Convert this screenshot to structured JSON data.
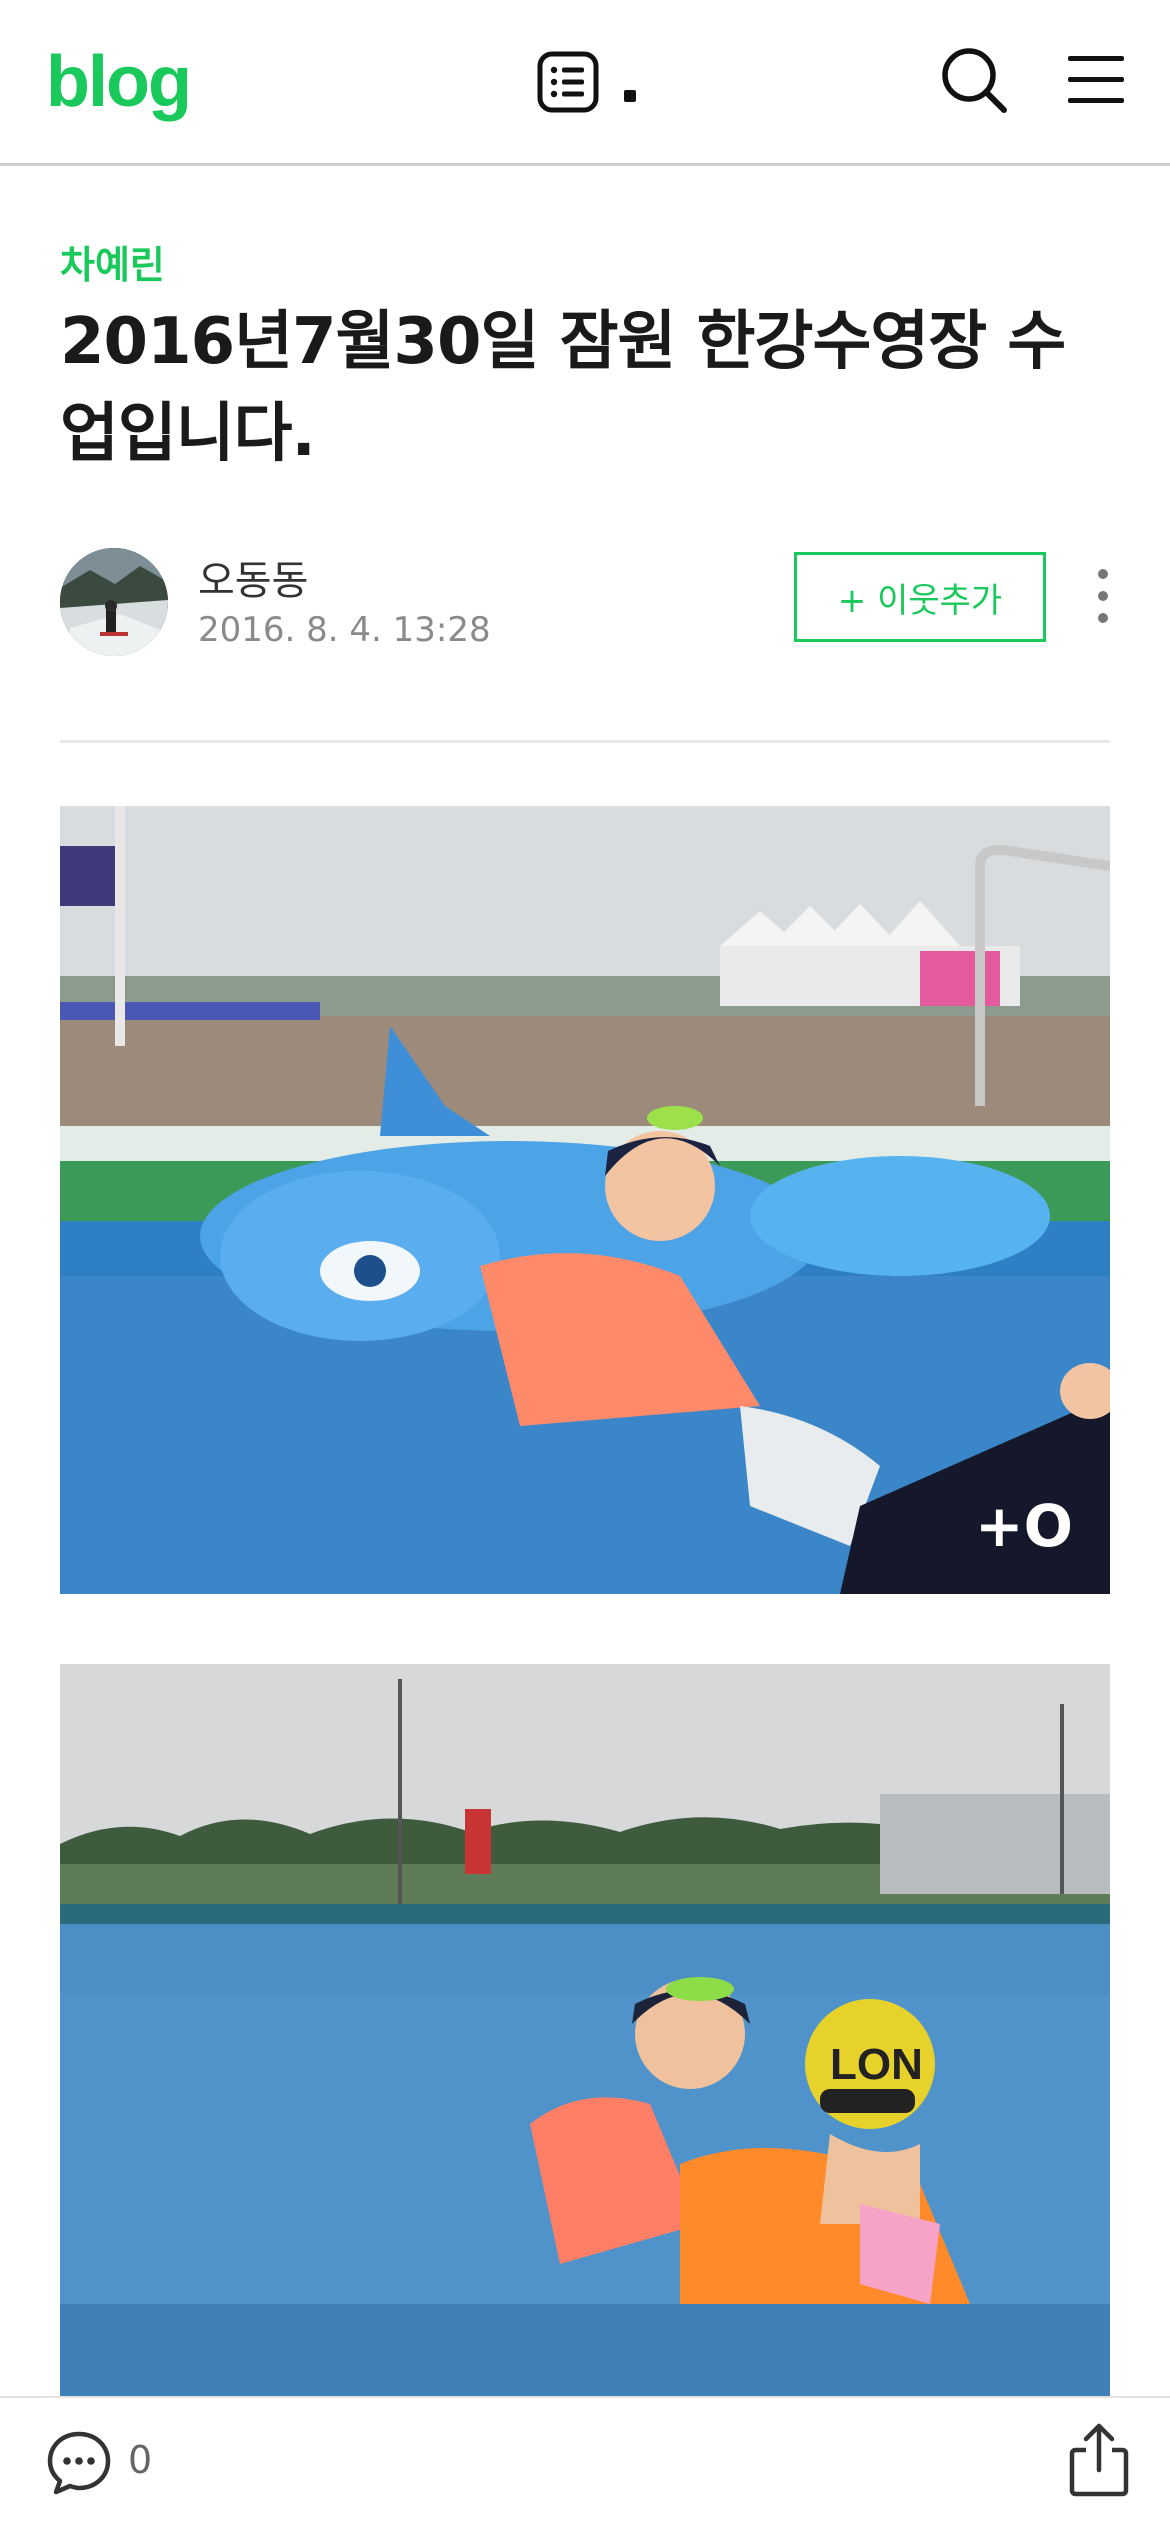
{
  "header": {
    "logo": "blog",
    "list_icon": "list-icon",
    "dot": "·",
    "search_icon": "search-icon",
    "menu_icon": "hamburger-menu-icon"
  },
  "post": {
    "category": "차예린",
    "title": "2016년7월30일 잠원 한강수영장 수업입니다.",
    "author": "오동동",
    "date": "2016. 8. 4. 13:28",
    "follow_label": "+ 이웃추가"
  },
  "footer": {
    "comment_count": "0"
  },
  "colors": {
    "brand_green": "#19c95b",
    "text_dark": "#1a1a1a",
    "text_muted": "#8a8a8a"
  }
}
